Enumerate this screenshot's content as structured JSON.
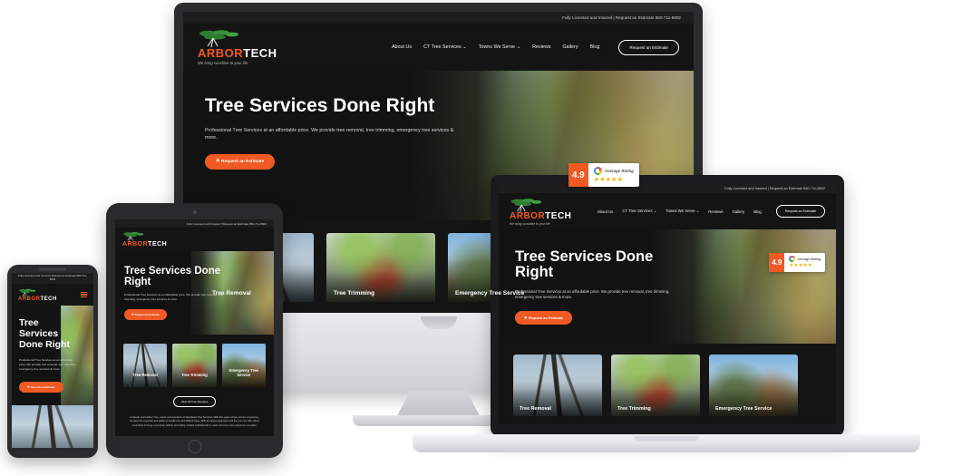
{
  "site": {
    "topbar_text": "Fully Licensed and Insured | Request an Estimate 860-711-8802",
    "brand": {
      "word_orange": "ARBOR",
      "word_white": "TECH",
      "tagline": "We bring sunshine to your life"
    },
    "nav": [
      {
        "label": "About Us",
        "caret": ""
      },
      {
        "label": "CT Tree Services",
        "caret": "⌄"
      },
      {
        "label": "Towns We Serve",
        "caret": "⌄"
      },
      {
        "label": "Reviews",
        "caret": ""
      },
      {
        "label": "Gallery",
        "caret": ""
      },
      {
        "label": "Blog",
        "caret": ""
      }
    ],
    "nav_cta": "Request an Estimate",
    "hero": {
      "title": "Tree Services Done Right",
      "subtitle": "Professional Tree Services at an affordable price. We provide tree removal, tree trimming, emergency tree services & more.",
      "cta": "Request an Estimate",
      "cta_icon": "⚑",
      "cta_mobile": "Get a Free Estimate"
    },
    "rating": {
      "score": "4.9",
      "label": "Average Rating",
      "stars": "★★★★★",
      "logo": "google-g-logo",
      "accent": "#ef5a24"
    },
    "services": [
      {
        "label": "Tree Removal"
      },
      {
        "label": "Tree Trimming"
      },
      {
        "label": "Emergency Tree Service"
      }
    ],
    "view_all": "View All Tree Services",
    "about_copy": "At Jaselo and Laskey Tree, owner and operators of Islandwick Tree Services, With 20+ years of tree service experience, we have the expertise and ability to handle tree and difficult trees. With the latest equipment and the men we offer. We're committed to being a punctual, skilled, and safety-minded professionals to each and every tree project we complete."
  },
  "devices": {
    "desktop": "imac-desktop-monitor",
    "laptop": "laptop-device",
    "tablet": "tablet-device",
    "phone": "smartphone-device"
  }
}
